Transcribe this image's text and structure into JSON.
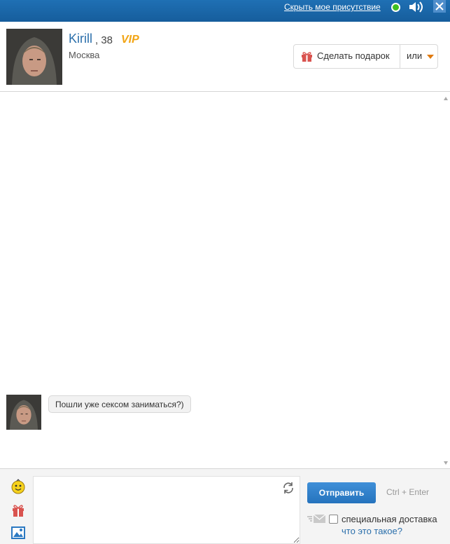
{
  "topbar": {
    "hide_presence_link": "Скрыть мое присутствие",
    "status_color": "#3fbf1f",
    "icons": [
      "online-status-icon",
      "sound-icon",
      "close-icon"
    ]
  },
  "profile": {
    "name": "Kirill",
    "age": ", 38",
    "vip_badge": "VIP",
    "city": "Москва"
  },
  "actions": {
    "gift_label": "Сделать подарок",
    "or_label": "или"
  },
  "messages": [
    {
      "text": "Пошли уже сексом заниматься?)"
    }
  ],
  "composer": {
    "input_value": "",
    "send_label": "Отправить",
    "send_hint": "Ctrl + Enter",
    "special_delivery_label": "специальная доставка",
    "special_delivery_checked": false,
    "what_is_it_link": "что это такое?"
  },
  "colors": {
    "topbar": "#1f70b4",
    "link": "#2b6fab",
    "vip": "#f2a515",
    "send_button": "#2f80cb"
  }
}
